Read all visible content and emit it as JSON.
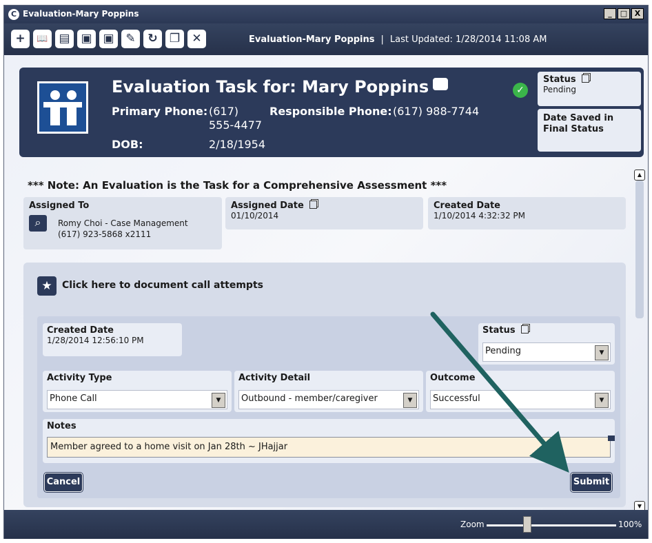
{
  "window": {
    "title": "Evaluation-Mary Poppins",
    "controls": {
      "minimize": "_",
      "maximize": "□",
      "close": "X"
    }
  },
  "toolbar": {
    "buttons": [
      {
        "name": "add-icon",
        "glyph": "+"
      },
      {
        "name": "book-icon",
        "glyph": "📖"
      },
      {
        "name": "document-icon",
        "glyph": "▤"
      },
      {
        "name": "save-icon",
        "glyph": "▣"
      },
      {
        "name": "save-close-icon",
        "glyph": "▣"
      },
      {
        "name": "edit-icon",
        "glyph": "✎"
      },
      {
        "name": "refresh-icon",
        "glyph": "↻"
      },
      {
        "name": "copy-icon",
        "glyph": "❐"
      },
      {
        "name": "close-icon",
        "glyph": "✕"
      }
    ],
    "record_name": "Evaluation-Mary Poppins",
    "separator": "|",
    "last_updated": "Last Updated: 1/28/2014 11:08 AM"
  },
  "header": {
    "title": "Evaluation Task for: Mary Poppins",
    "primary_phone_label": "Primary Phone:",
    "primary_phone_line1": "(617)",
    "primary_phone_line2": "555-4477",
    "responsible_phone_label": "Responsible Phone:",
    "responsible_phone_value": "(617) 988-7744",
    "dob_label": "DOB:",
    "dob_value": "2/18/1954",
    "status_label": "Status",
    "status_value": "Pending",
    "date_saved_label": "Date Saved in Final Status"
  },
  "note": "*** Note: An Evaluation is the Task for a Comprehensive Assessment ***",
  "assigned": {
    "assigned_to_label": "Assigned To",
    "assigned_to_name": "Romy Choi - Case Management",
    "assigned_to_phone": "(617) 923-5868 x2111",
    "assigned_date_label": "Assigned Date",
    "assigned_date_value": "01/10/2014",
    "created_date_label": "Created Date",
    "created_date_value": "1/10/2014 4:32:32 PM"
  },
  "activity": {
    "call_attempts_link": "Click here to document call attempts",
    "created_date_label": "Created Date",
    "created_date_value": "1/28/2014 12:56:10 PM",
    "status_label": "Status",
    "status_value": "Pending",
    "activity_type_label": "Activity Type",
    "activity_type_value": "Phone Call",
    "activity_detail_label": "Activity Detail",
    "activity_detail_value": "Outbound - member/caregiver",
    "outcome_label": "Outcome",
    "outcome_value": "Successful",
    "notes_label": "Notes",
    "notes_value": "Member agreed to a home visit on Jan 28th ~ JHajjar",
    "cancel_label": "Cancel",
    "submit_label": "Submit"
  },
  "footer": {
    "zoom_label": "Zoom",
    "zoom_value": "100%",
    "zoom_level_fraction": 0.35
  },
  "colors": {
    "navy": "#2c3a5a",
    "annotation_arrow": "#1f6260",
    "success_green": "#3bb54a",
    "notes_background": "#fbf1dc"
  }
}
